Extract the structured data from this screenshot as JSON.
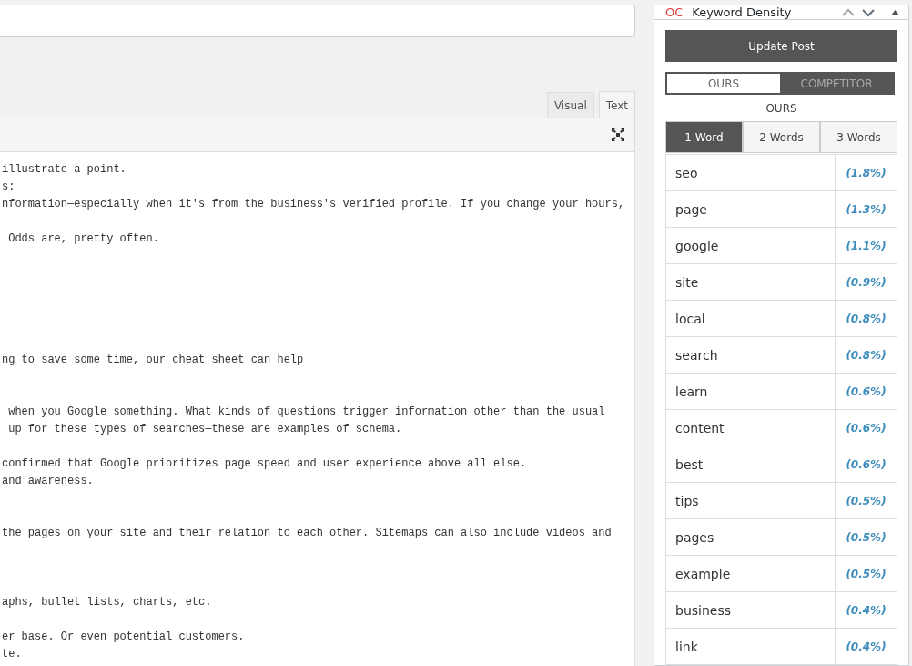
{
  "editor": {
    "tabs": [
      {
        "label": "Visual",
        "selected": false
      },
      {
        "label": "Text",
        "selected": true
      }
    ],
    "content": "illustrate a point.\ns:\nnformation—especially when it's from the business's verified profile. If you change your hours,\n\n Odds are, pretty often.\n\n\n\n\n\n\nng to save some time, our cheat sheet can help\n\n\n when you Google something. What kinds of questions trigger information other than the usual\n up for these types of searches—these are examples of schema.\n\nconfirmed that Google prioritizes page speed and user experience above all else.\nand awareness.\n\n\nthe pages on your site and their relation to each other. Sitemaps can also include videos and\n\n\n\naphs, bullet lists, charts, etc.\n\ner base. Or even potential customers.\nte."
  },
  "panel": {
    "brand": "OC",
    "title": "Keyword Density",
    "update_button": "Update Post",
    "source_toggle": [
      {
        "label": "OURS",
        "selected": true
      },
      {
        "label": "COMPETITOR",
        "selected": false
      }
    ],
    "source_label": "OURS",
    "word_tabs": [
      {
        "label": "1 Word",
        "selected": true
      },
      {
        "label": "2 Words",
        "selected": false
      },
      {
        "label": "3 Words",
        "selected": false
      }
    ],
    "keywords": [
      {
        "word": "seo",
        "density": "(1.8%)"
      },
      {
        "word": "page",
        "density": "(1.3%)"
      },
      {
        "word": "google",
        "density": "(1.1%)"
      },
      {
        "word": "site",
        "density": "(0.9%)"
      },
      {
        "word": "local",
        "density": "(0.8%)"
      },
      {
        "word": "search",
        "density": "(0.8%)"
      },
      {
        "word": "learn",
        "density": "(0.6%)"
      },
      {
        "word": "content",
        "density": "(0.6%)"
      },
      {
        "word": "best",
        "density": "(0.6%)"
      },
      {
        "word": "tips",
        "density": "(0.5%)"
      },
      {
        "word": "pages",
        "density": "(0.5%)"
      },
      {
        "word": "example",
        "density": "(0.5%)"
      },
      {
        "word": "business",
        "density": "(0.4%)"
      },
      {
        "word": "link",
        "density": "(0.4%)"
      }
    ]
  }
}
